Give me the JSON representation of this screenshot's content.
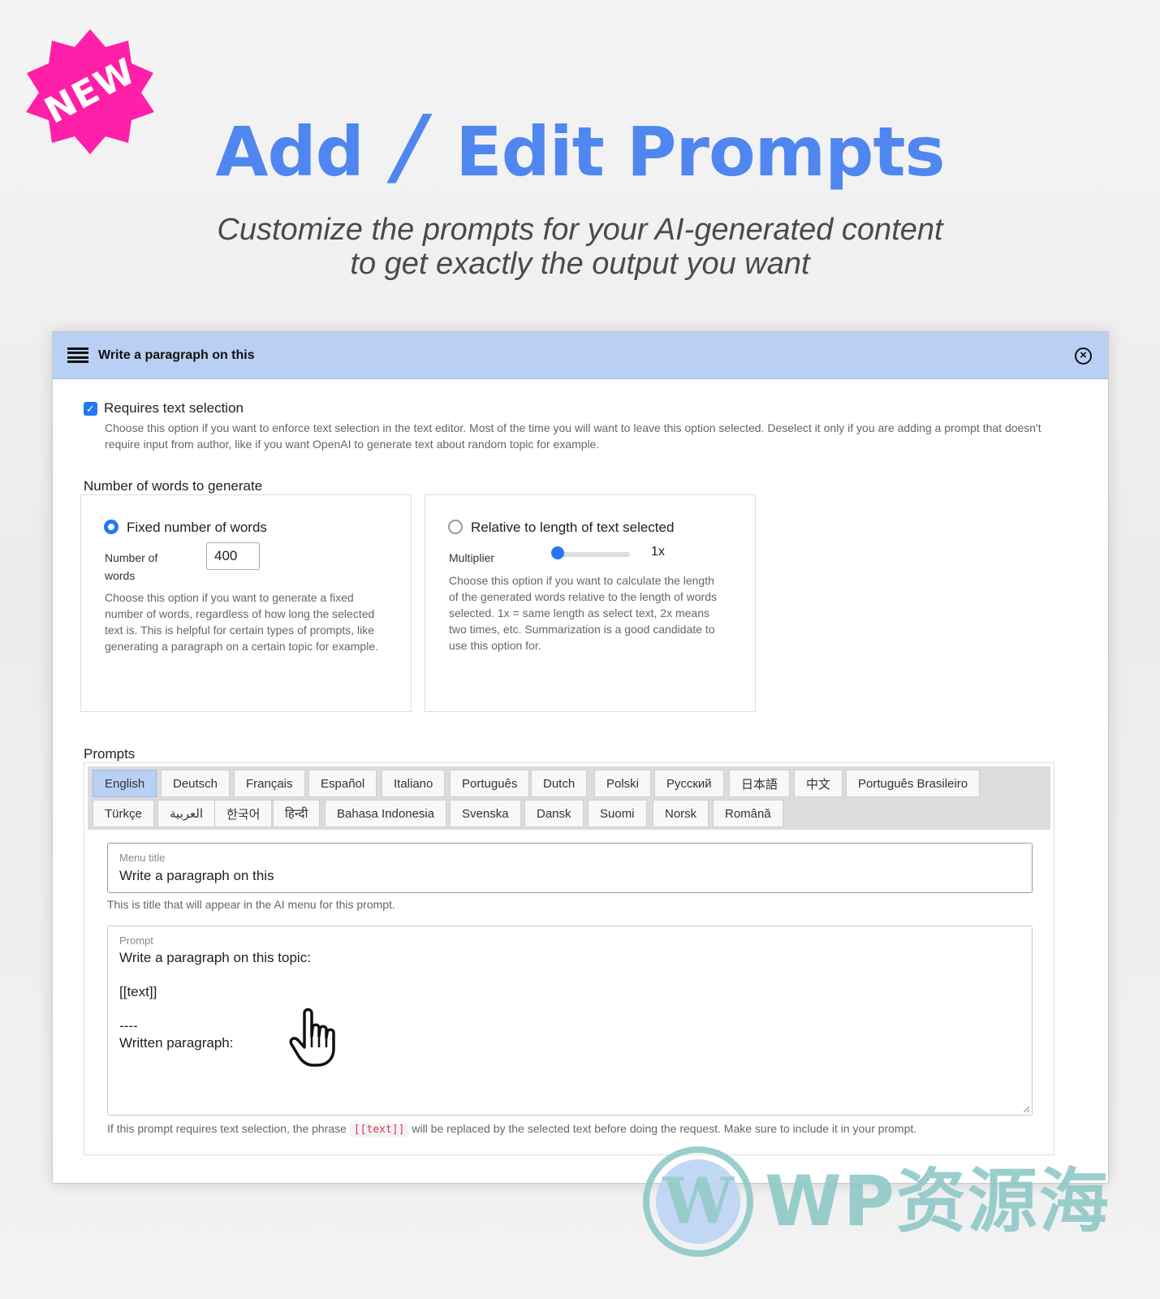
{
  "badge": {
    "text": "NEW",
    "color": "#ff1fa8"
  },
  "hero": {
    "title_add": "Add",
    "title_slash": "/",
    "title_edit": "Edit Prompts",
    "subtitle_line1": "Customize the prompts for your AI-generated content",
    "subtitle_line2": "to get exactly the output you want",
    "accent": "#4f86ef"
  },
  "dialog": {
    "title": "Write a paragraph on this",
    "header_color": "#b9cff4",
    "requires_selection": {
      "checked": true,
      "label": "Requires text selection",
      "help": "Choose this option if you want to enforce text selection in the text editor. Most of the time you will want to leave this option selected. Deselect it only if you are adding a prompt that doesn't require input from author, like if you want OpenAI to generate text about random topic for example."
    },
    "words_section_label": "Number of words to generate",
    "fixed_option": {
      "selected": true,
      "label": "Fixed number of words",
      "field_label": "Number of words",
      "value": "400",
      "help": "Choose this option if you want to generate a fixed number of words, regardless of how long the selected text is. This is helpful for certain types of prompts, like generating a paragraph on a certain topic for example."
    },
    "relative_option": {
      "selected": false,
      "label": "Relative to length of text selected",
      "field_label": "Multiplier",
      "value": "1x",
      "help": "Choose this option if you want to calculate the length of the generated words relative to the length of words selected. 1x = same length as select text, 2x means two times, etc. Summarization is a good candidate to use this option for."
    },
    "prompts_label": "Prompts",
    "tabs_row1": [
      "English",
      "Deutsch",
      "Français",
      "Español",
      "Italiano",
      "Português",
      "Dutch",
      "Polski",
      "Русский",
      "日本語",
      "中文",
      "Português Brasileiro"
    ],
    "tabs_row2": [
      "Türkçe",
      "العربية",
      "한국어",
      "हिन्दी",
      "Bahasa Indonesia",
      "Svenska",
      "Dansk",
      "Suomi",
      "Norsk",
      "Română"
    ],
    "active_tab": "English",
    "menu_title": {
      "caption": "Menu title",
      "value": "Write a paragraph on this",
      "help": "This is title that will appear in the AI menu for this prompt."
    },
    "prompt": {
      "caption": "Prompt",
      "value": "Write a paragraph on this topic:\n\n[[text]]\n\n----\nWritten paragraph:",
      "help_before": "If this prompt requires text selection, the phrase",
      "help_code": "[[text]]",
      "help_after": "will be replaced by the selected text before doing the request. Make sure to include it in your prompt."
    }
  },
  "watermark": {
    "text": "WP资源海"
  }
}
